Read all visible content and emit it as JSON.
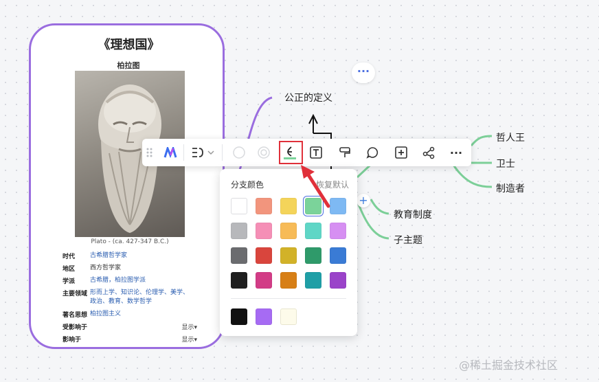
{
  "card": {
    "title": "《理想国》",
    "subtitle": "柏拉图",
    "caption": "Plato - (ca. 427-347 B.C.)",
    "rows": [
      {
        "key": "时代",
        "value": "古希腊哲学家"
      },
      {
        "key": "地区",
        "value": "西方哲学家"
      },
      {
        "key": "学派",
        "value": "古希腊，柏拉图学派"
      },
      {
        "key": "主要领域",
        "value": "形而上学、知识论、伦理学、美学、政治、教育、数学哲学"
      },
      {
        "key": "著名思想",
        "value": "柏拉图主义"
      },
      {
        "key": "受影响于",
        "value": "",
        "show": "显示▾"
      },
      {
        "key": "影响于",
        "value": "",
        "show": "显示▾"
      }
    ]
  },
  "mindmap": {
    "node_justice": "公正的定义",
    "node_philosopher_king": "哲人王",
    "node_guard": "卫士",
    "node_maker": "制造者",
    "node_education": "教育制度",
    "node_subtopic": "子主题",
    "more_bubble": "···",
    "add_symbol": "+"
  },
  "toolbar": {
    "items": [
      "drag-handle",
      "ai-logo",
      "layout",
      "dropdown",
      "circle-outline",
      "circle-double",
      "branch-color",
      "text-style",
      "paint-brush",
      "comment",
      "add-node",
      "relationship",
      "more"
    ],
    "more_label": "···"
  },
  "color_popup": {
    "title": "分支颜色",
    "reset": "恢复默认",
    "rows": [
      [
        "#ffffff",
        "#f2957d",
        "#f4d45a",
        "#7bd39a",
        "#7eb9f3"
      ],
      [
        "#b7b8bb",
        "#f58fb6",
        "#f7bb57",
        "#5fd6c6",
        "#d68ff2"
      ],
      [
        "#6b6c6f",
        "#d9453d",
        "#d2b228",
        "#2f9a6a",
        "#3a7bd5"
      ],
      [
        "#1f1f1f",
        "#d23c86",
        "#d77f16",
        "#1f9fa6",
        "#9a43c9"
      ]
    ],
    "extra": [
      "#111111",
      "#a66bf3",
      "#fdfbea"
    ],
    "selected": "#7bd39a"
  },
  "colors": {
    "card_border": "#9a6ddf",
    "branch_green": "#7ccf98",
    "highlight_red": "#e0303a",
    "accent_blue": "#3d7de0"
  },
  "watermark": "@稀土掘金技术社区"
}
